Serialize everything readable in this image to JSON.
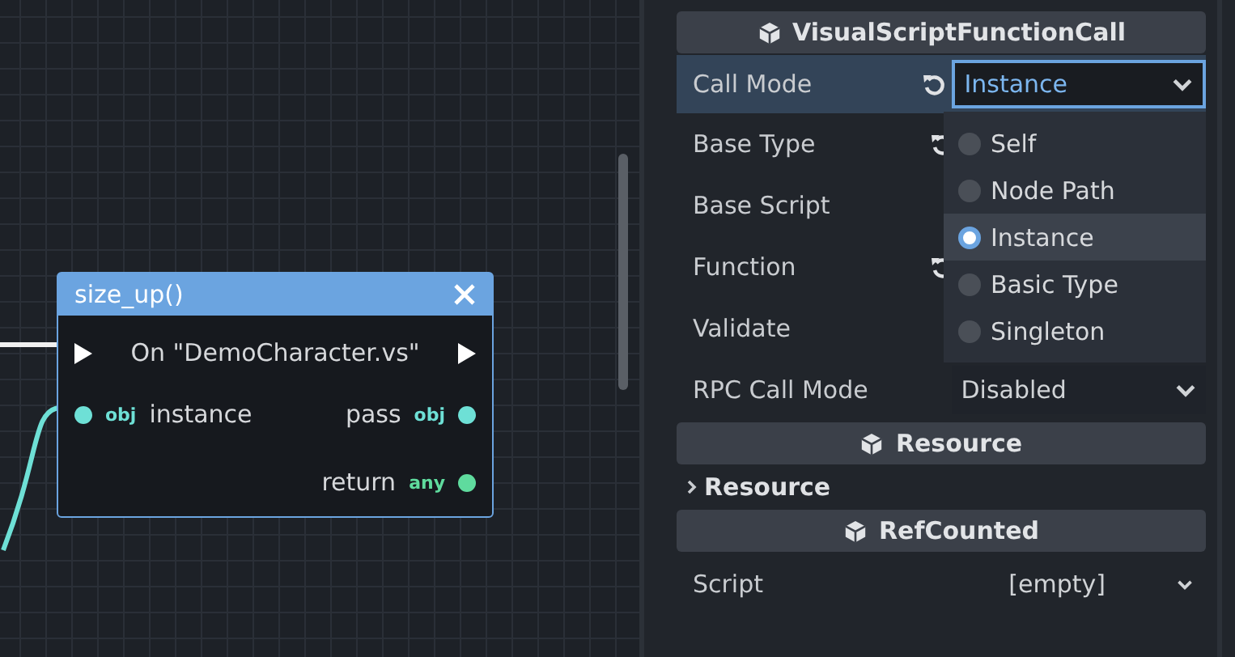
{
  "graph": {
    "node": {
      "title": "size_up()",
      "rows": [
        {
          "kind": "sequence",
          "label": "On \"DemoCharacter.vs\""
        },
        {
          "kind": "ports",
          "left": {
            "label": "instance",
            "type": "obj",
            "color": "#6ee0d6"
          },
          "right": {
            "label": "pass",
            "type": "obj",
            "color": "#6ee0d6"
          }
        },
        {
          "kind": "ports",
          "right": {
            "label": "return",
            "type": "any",
            "color": "#5fdb9e"
          }
        }
      ]
    }
  },
  "inspector": {
    "items": [
      {
        "kind": "header",
        "title": "VisualScriptFunctionCall"
      },
      {
        "kind": "dropdown",
        "label": "Call Mode",
        "value": "Instance",
        "revert": true,
        "selected": true,
        "open": true,
        "options": [
          {
            "label": "Self",
            "selected": false
          },
          {
            "label": "Node Path",
            "selected": false
          },
          {
            "label": "Instance",
            "selected": true
          },
          {
            "label": "Basic Type",
            "selected": false
          },
          {
            "label": "Singleton",
            "selected": false
          }
        ]
      },
      {
        "kind": "property",
        "label": "Base Type",
        "revert": true,
        "selected": false
      },
      {
        "kind": "property",
        "label": "Base Script",
        "revert": false,
        "selected": false
      },
      {
        "kind": "property",
        "label": "Function",
        "revert": true,
        "selected": false
      },
      {
        "kind": "property",
        "label": "Validate",
        "revert": false,
        "selected": false
      },
      {
        "kind": "dropdown",
        "label": "RPC Call Mode",
        "value": "Disabled",
        "revert": false,
        "selected": false,
        "open": false
      },
      {
        "kind": "header",
        "title": "Resource"
      },
      {
        "kind": "category",
        "title": "Resource",
        "expanded": false
      },
      {
        "kind": "header",
        "title": "RefCounted"
      },
      {
        "kind": "resource",
        "label": "Script",
        "value": "[empty]",
        "revert": false,
        "selected": false
      }
    ]
  }
}
